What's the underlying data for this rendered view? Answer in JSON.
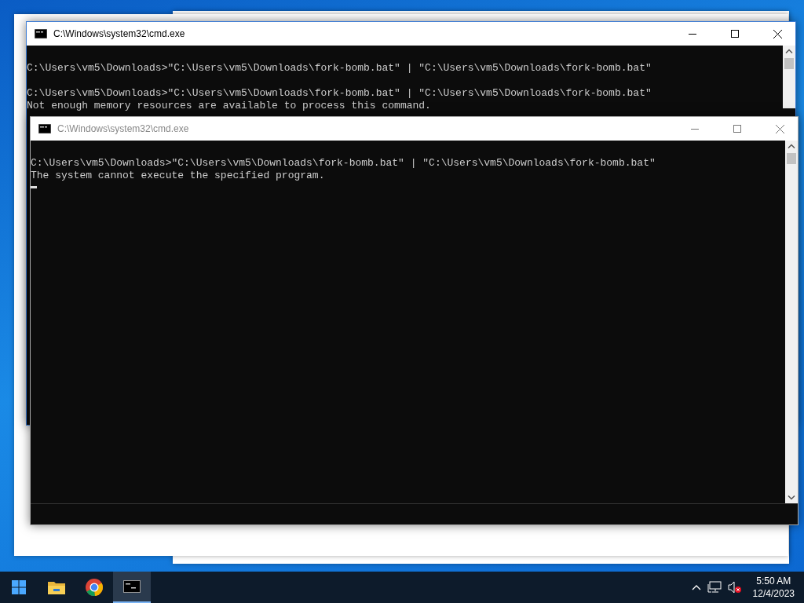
{
  "windows": [
    {
      "title": "C:\\Windows\\system32\\cmd.exe",
      "active": true,
      "lines": [
        {
          "kind": "blank"
        },
        {
          "kind": "text",
          "text": "C:\\Users\\vm5\\Downloads>\"C:\\Users\\vm5\\Downloads\\fork-bomb.bat\" | \"C:\\Users\\vm5\\Downloads\\fork-bomb.bat\""
        },
        {
          "kind": "blank"
        },
        {
          "kind": "text",
          "text": "C:\\Users\\vm5\\Downloads>\"C:\\Users\\vm5\\Downloads\\fork-bomb.bat\" | \"C:\\Users\\vm5\\Downloads\\fork-bomb.bat\""
        },
        {
          "kind": "text",
          "text": "Not enough memory resources are available to process this command."
        }
      ]
    },
    {
      "title": "C:\\Windows\\system32\\cmd.exe",
      "active": false,
      "lines": [
        {
          "kind": "blank"
        },
        {
          "kind": "text",
          "text": "C:\\Users\\vm5\\Downloads>\"C:\\Users\\vm5\\Downloads\\fork-bomb.bat\" | \"C:\\Users\\vm5\\Downloads\\fork-bomb.bat\""
        },
        {
          "kind": "text",
          "text": "The system cannot execute the specified program."
        }
      ],
      "cursor": true
    }
  ],
  "taskbar": {
    "apps": [
      {
        "kind": "start",
        "selected": false
      },
      {
        "kind": "explorer",
        "selected": false
      },
      {
        "kind": "chrome",
        "selected": false
      },
      {
        "kind": "terminal",
        "selected": true
      }
    ],
    "time": "5:50 AM",
    "date": "12/4/2023"
  }
}
